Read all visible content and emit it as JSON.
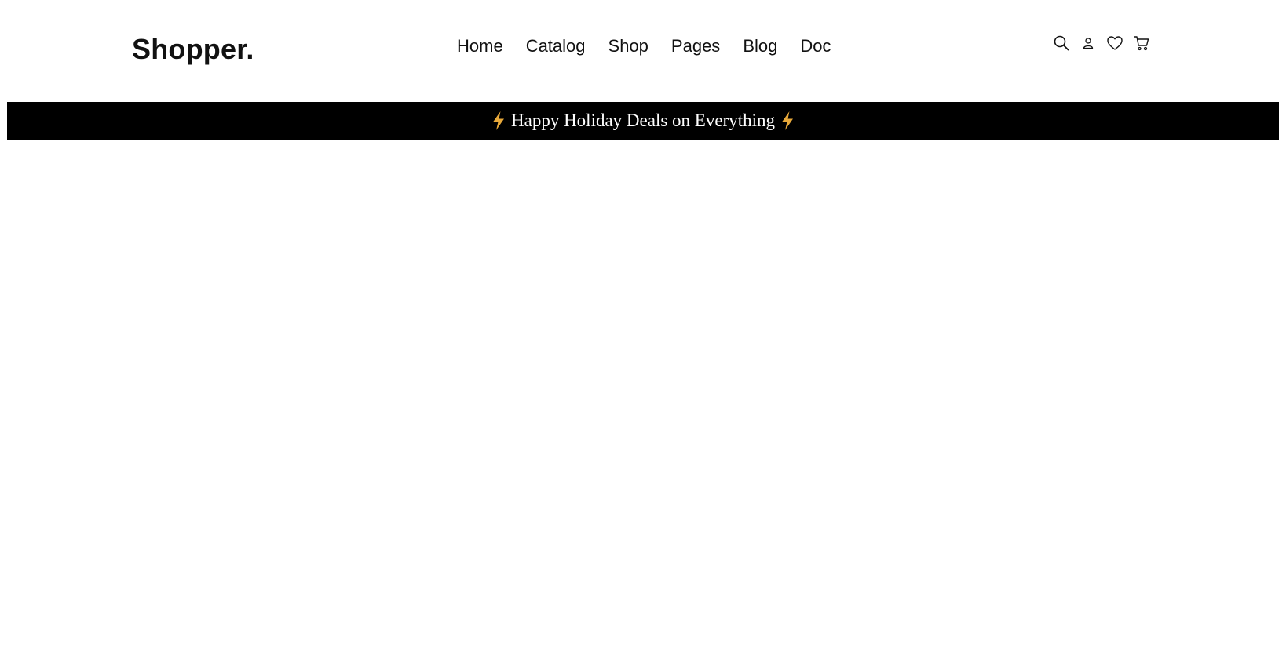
{
  "header": {
    "logo": "Shopper.",
    "nav": {
      "home": "Home",
      "catalog": "Catalog",
      "shop": "Shop",
      "pages": "Pages",
      "blog": "Blog",
      "doc": "Doc"
    },
    "tools": {
      "icons": [
        "search-icon",
        "user-icon",
        "heart-icon",
        "cart-icon"
      ]
    }
  },
  "promo": {
    "text": "Happy Holiday Deals on Everything",
    "icon": "lightning-bolt-icon",
    "bolt_color": "#E8A93A",
    "background": "#000000",
    "text_color": "#FFFFFF"
  }
}
